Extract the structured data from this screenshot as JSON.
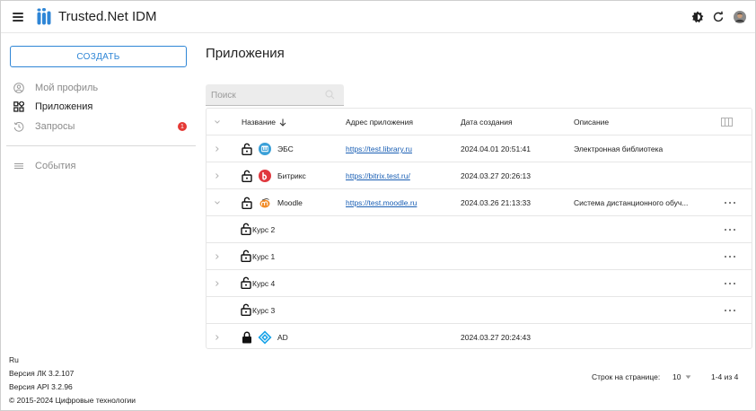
{
  "header": {
    "title": "Trusted.Net IDM",
    "icons": [
      "menu-icon",
      "theme-icon",
      "refresh-icon",
      "user-avatar"
    ]
  },
  "sidebar": {
    "create_label": "СОЗДАТЬ",
    "items": [
      {
        "label": "Мой профиль",
        "icon": "profile-icon",
        "state": "disabled"
      },
      {
        "label": "Приложения",
        "icon": "apps-icon",
        "state": "active"
      },
      {
        "label": "Запросы",
        "icon": "history-icon",
        "state": "disabled",
        "badge": "1"
      },
      {
        "label": "События",
        "icon": "list-icon",
        "state": "disabled"
      }
    ],
    "footer": {
      "lang": "Ru",
      "version_lk": "Версия ЛК 3.2.107",
      "version_api": "Версия API 3.2.96",
      "copyright": "© 2015-2024 Цифровые технологии"
    }
  },
  "main": {
    "title": "Приложения",
    "search_placeholder": "Поиск",
    "columns": {
      "name": "Название",
      "address": "Адрес приложения",
      "created": "Дата создания",
      "description": "Описание"
    },
    "rows": [
      {
        "name": "ЭБС",
        "address": "https://test.library.ru",
        "created": "2024.04.01 20:51:41",
        "description": "Электронная библиотека",
        "logo": "ebs-logo",
        "lock": "open"
      },
      {
        "name": "Битрикс",
        "address": "https://bitrix.test.ru/",
        "created": "2024.03.27 20:26:13",
        "description": "",
        "logo": "bitrix-logo",
        "lock": "open"
      },
      {
        "name": "Moodle",
        "address": "https://test.moodle.ru",
        "created": "2024.03.26 21:13:33",
        "description": "Система дистанционного обуч...",
        "logo": "moodle-logo",
        "lock": "open",
        "expanded": true
      },
      {
        "name": "Курс 2",
        "child": true,
        "lock": "open"
      },
      {
        "name": "Курс 1",
        "child": true,
        "lock": "open"
      },
      {
        "name": "Курс 4",
        "child": true,
        "lock": "open"
      },
      {
        "name": "Курс 3",
        "child": true,
        "lock": "open"
      },
      {
        "name": "AD",
        "address": "",
        "created": "2024.03.27 20:24:43",
        "description": "",
        "logo": "ad-logo",
        "lock": "closed"
      }
    ],
    "pagination": {
      "rows_per_page_label": "Строк на странице:",
      "rows_per_page": "10",
      "range": "1-4 из 4"
    }
  },
  "colors": {
    "accent": "#2f86d6",
    "badge": "#e53935",
    "link": "#1a5fb4",
    "ebs": "#3aa0d8",
    "bitrix": "#e0383e",
    "moodle": "#f28c28",
    "ad": "#1aa3e8"
  }
}
